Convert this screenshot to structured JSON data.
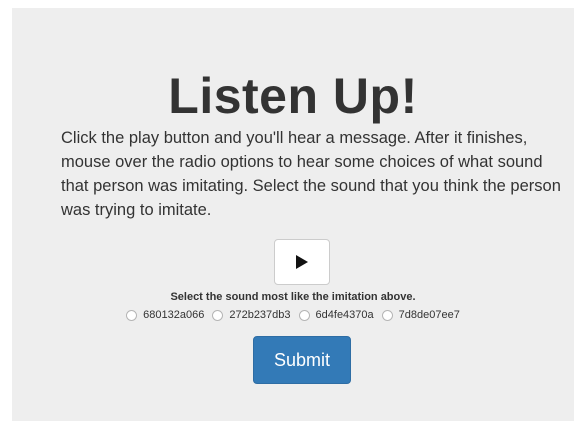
{
  "title": "Listen Up!",
  "description": "Click the play button and you'll hear a message. After it finishes, mouse over the radio options to hear some choices of what sound that person was imitating. Select the sound that you think the person was trying to imitate.",
  "play_button": {
    "icon": "play-icon"
  },
  "prompt": "Select the sound most like the imitation above.",
  "options": [
    {
      "label": "680132a066",
      "selected": false
    },
    {
      "label": "272b237db3",
      "selected": false
    },
    {
      "label": "6d4fe4370a",
      "selected": false
    },
    {
      "label": "7d8de07ee7",
      "selected": false
    }
  ],
  "submit_label": "Submit",
  "colors": {
    "panel_bg": "#eeeeee",
    "primary": "#337ab7",
    "text": "#333333"
  }
}
